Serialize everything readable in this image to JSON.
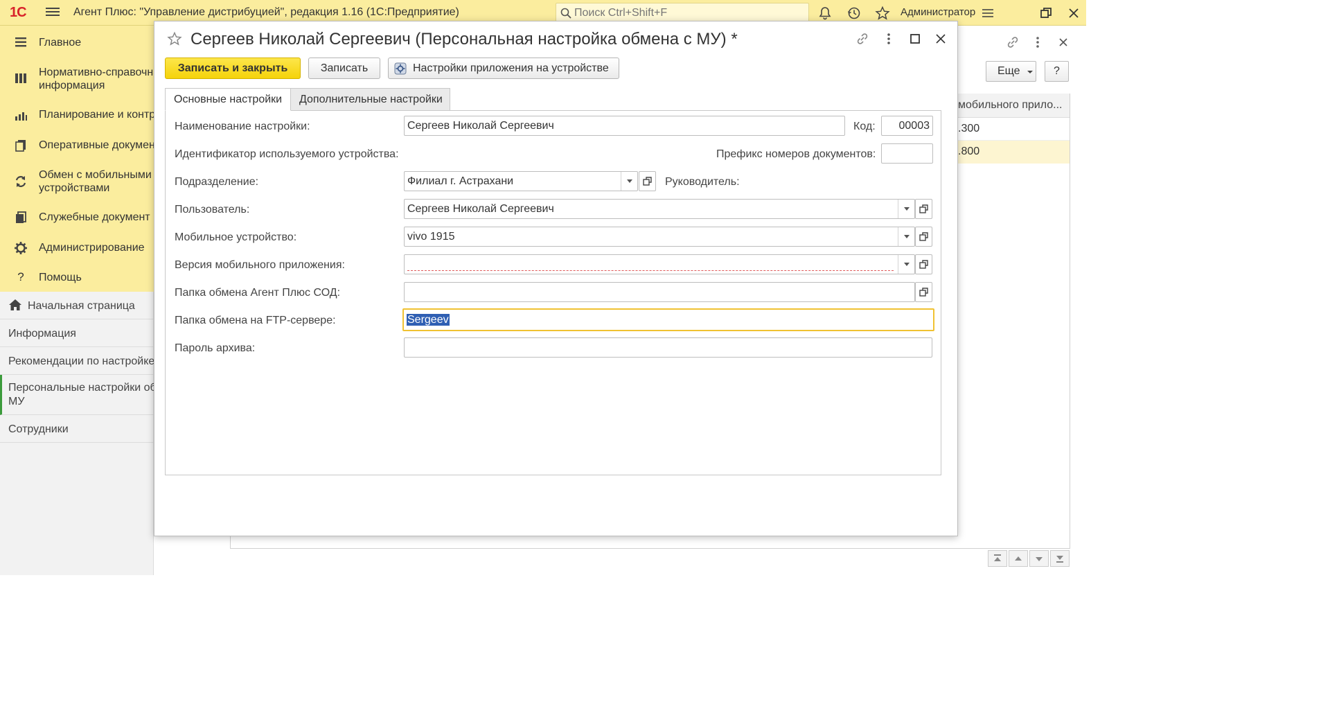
{
  "app": {
    "title": "Агент Плюс: \"Управление дистрибуцией\", редакция 1.16  (1С:Предприятие)",
    "logo": "1С",
    "search_placeholder": "Поиск Ctrl+Shift+F",
    "user": "Администратор"
  },
  "sections": [
    {
      "label": "Главное",
      "icon": "menu-lines-icon"
    },
    {
      "label": "Нормативно-справочная информация",
      "line1": "Нормативно-справочна",
      "line2": "информация",
      "icon": "catalog-icon"
    },
    {
      "label": "Планирование и контр",
      "icon": "chart-icon"
    },
    {
      "label": "Оперативные докумен",
      "icon": "documents-icon"
    },
    {
      "label": "Обмен с мобильными устройствами",
      "line1": "Обмен с мобильными",
      "line2": "устройствами",
      "icon": "exchange-icon"
    },
    {
      "label": "Служебные документ",
      "icon": "service-docs-icon"
    },
    {
      "label": "Администрирование",
      "icon": "gear-icon"
    },
    {
      "label": "Помощь",
      "icon": "help-icon"
    }
  ],
  "nav": {
    "home": "Начальная страница",
    "items": [
      {
        "label": "Информация"
      },
      {
        "label": "Рекомендации по настройке"
      },
      {
        "label": "Персональные настройки обмена с МУ",
        "line1": "Персональные настройки об",
        "line2": "МУ",
        "active": true
      },
      {
        "label": "Сотрудники"
      }
    ]
  },
  "background_form": {
    "more_button": "Еще",
    "help_button": "?",
    "column_header": "мобильного прило...",
    "rows": [
      ".300",
      ".800"
    ]
  },
  "modal": {
    "title": "Сергеев Николай Сергеевич (Персональная настройка обмена с МУ) *",
    "buttons": {
      "save_close": "Записать и закрыть",
      "save": "Записать",
      "device_settings": "Настройки приложения на устройстве"
    },
    "tabs": [
      {
        "label": "Основные настройки",
        "active": true
      },
      {
        "label": "Дополнительные настройки",
        "active": false
      }
    ],
    "form": {
      "name_label": "Наименование настройки:",
      "name_value": "Сергеев Николай Сергеевич",
      "code_label": "Код:",
      "code_value": "00003",
      "device_id_label": "Идентификатор используемого устройства:",
      "prefix_label": "Префикс номеров документов:",
      "prefix_value": "",
      "division_label": "Подразделение:",
      "division_value": "Филиал г. Астрахани",
      "manager_label": "Руководитель:",
      "user_label": "Пользователь:",
      "user_value": "Сергеев Николай Сергеевич",
      "device_label": "Мобильное устройство:",
      "device_value": "vivo 1915",
      "app_version_label": "Версия мобильного приложения:",
      "app_version_value": "",
      "exchange_folder_label": "Папка обмена Агент Плюс СОД:",
      "exchange_folder_value": "",
      "ftp_folder_label": "Папка обмена на FTP-сервере:",
      "ftp_folder_value": "Sergeev",
      "archive_password_label": "Пароль архива:",
      "archive_password_value": ""
    }
  },
  "colors": {
    "topbar": "#fbed9e",
    "primary_button": "#f5d30a",
    "focus_border": "#f0c232",
    "active_nav_marker": "#3c9b3c",
    "logo": "#d8232a"
  }
}
